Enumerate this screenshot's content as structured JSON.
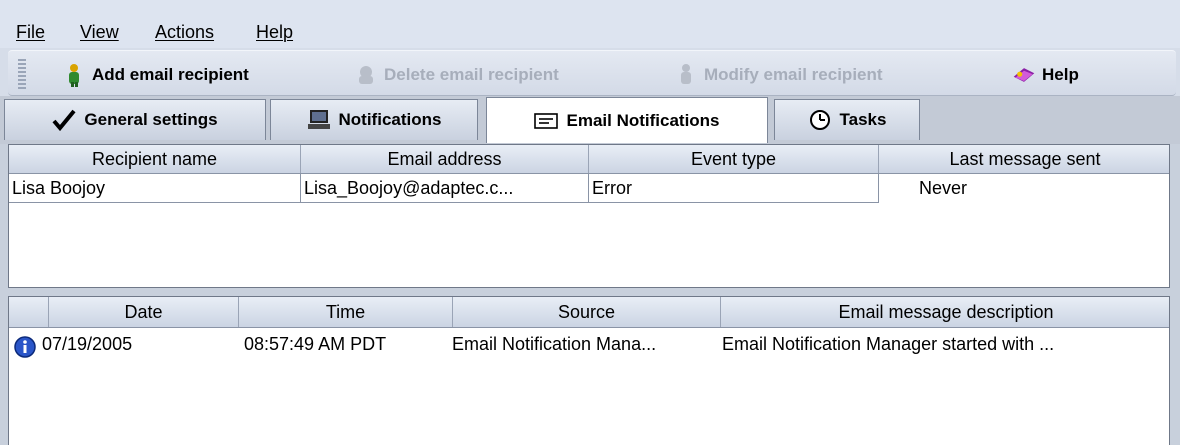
{
  "menu": {
    "file": "File",
    "view": "View",
    "actions": "Actions",
    "help": "Help"
  },
  "toolbar": {
    "add_label": "Add email recipient",
    "delete_label": "Delete email recipient",
    "modify_label": "Modify email recipient",
    "help_label": "Help",
    "add_icon": "person-add-icon",
    "delete_icon": "person-delete-icon",
    "modify_icon": "person-modify-icon",
    "help_icon": "help-book-icon"
  },
  "tabs": [
    {
      "label": "General settings",
      "icon": "checkmark-icon"
    },
    {
      "label": "Notifications",
      "icon": "computer-icon"
    },
    {
      "label": "Email Notifications",
      "icon": "envelope-icon",
      "active": true
    },
    {
      "label": "Tasks",
      "icon": "clock-icon"
    }
  ],
  "recipients": {
    "columns": [
      "Recipient name",
      "Email address",
      "Event type",
      "Last message sent"
    ],
    "rows": [
      [
        "Lisa Boojoy",
        "Lisa_Boojoy@adaptec.c...",
        "Error",
        "Never"
      ]
    ]
  },
  "log": {
    "columns": [
      "Date",
      "Time",
      "Source",
      "Email message description"
    ],
    "rows": [
      {
        "icon": "info-icon",
        "date": "07/19/2005",
        "time": "08:57:49 AM PDT",
        "source": "Email Notification Mana...",
        "description": "Email Notification Manager started with ..."
      }
    ]
  },
  "colors": {
    "accent": "#1f4fb0",
    "disabled_text": "#a7aebb"
  }
}
